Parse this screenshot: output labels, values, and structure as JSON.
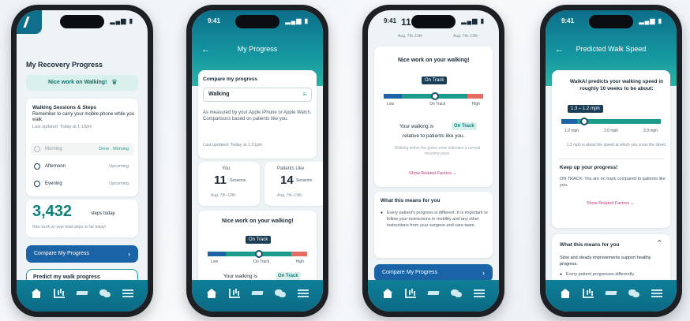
{
  "phone1": {
    "title": "My Recovery Progress",
    "banner": "Nice work on Walking!",
    "sessions_title": "Walking Sessions & Steps",
    "sessions_note": "Remember to carry your mobile phone while you walk.",
    "last_updated": "Last updated: Today at 1:13pm",
    "rows": [
      {
        "label": "Morning",
        "status": "Done · Morning"
      },
      {
        "label": "Afternoon",
        "status": "Upcoming"
      },
      {
        "label": "Evening",
        "status": "Upcoming"
      }
    ],
    "steps_value": "3,432",
    "steps_unit": "steps today",
    "steps_note": "Nice work on your total steps so far today!",
    "compare_button": "Compare My Progress",
    "predict_title": "Predict my walk progress"
  },
  "phone2": {
    "time": "9:41",
    "header": "My Progress",
    "compare_label": "Compare my progress",
    "select_value": "Walking",
    "note": "As measured by your Apple iPhone or Apple Watch. Comparisons based on patients like you.",
    "last_updated": "Last updated: Today at 1:01pm",
    "you_label": "You",
    "you_value": "11",
    "you_unit": "Sessions",
    "you_range": "Aug. 7th–13th",
    "patients_label": "Patients Like",
    "patients_value": "14",
    "patients_unit": "Sessions",
    "patients_range": "Aug. 7th–13th",
    "nice_work": "Nice work on your walking!",
    "pill": "On Track",
    "scale_low": "Low",
    "scale_on": "On Track",
    "scale_high": "High",
    "walking_is": "Your walking is",
    "status_chip": "On Track"
  },
  "phone3": {
    "time": "9:41",
    "top_value": "11",
    "top_range_a": "Aug. 7th–13th",
    "top_range_b": "Aug. 7th–13th",
    "nice_work": "Nice work on your walking!",
    "pill": "On Track",
    "scale_low": "Low",
    "scale_on": "On Track",
    "scale_high": "High",
    "walking_is": "Your walking is",
    "status_chip": "On Track",
    "relative": "relative to patients like you.",
    "grey_note": "Walking within the green zone indicates a normal recovery pace.",
    "factors_link": "Show Related Factors",
    "means_title": "What this means for you",
    "means_text": "Every patient's progress is different. It is important to follow your instructions in mobility and any other instructions from your surgeon and care team.",
    "compare_button": "Compare My Progress"
  },
  "phone4": {
    "time": "9:41",
    "header": "Predicted Walk Speed",
    "predict_text": "WalkAI predicts your walking speed in roughly 10 weeks to be about:",
    "pill": "1.3 – 1.2 mph",
    "scale_a": "1.0 mph",
    "scale_b": "2.0 mph",
    "scale_c": "3.0 mph",
    "scale_note": "1.3 mph is about the speed at which you cross the street.",
    "keep_title": "Keep up your progress!",
    "keep_text": "ON TRACK: You are on track compared to patients like you.",
    "factors_link": "Show Related Factors",
    "means_title": "What this means for you",
    "means_text": "Slow and steady improvements support healthy progress.",
    "bullet": "Every patient progresses differently."
  },
  "colors": {
    "teal": "#1597a0",
    "blue": "#1a63a6",
    "green": "#1c9c8a",
    "red": "#e46b62"
  }
}
